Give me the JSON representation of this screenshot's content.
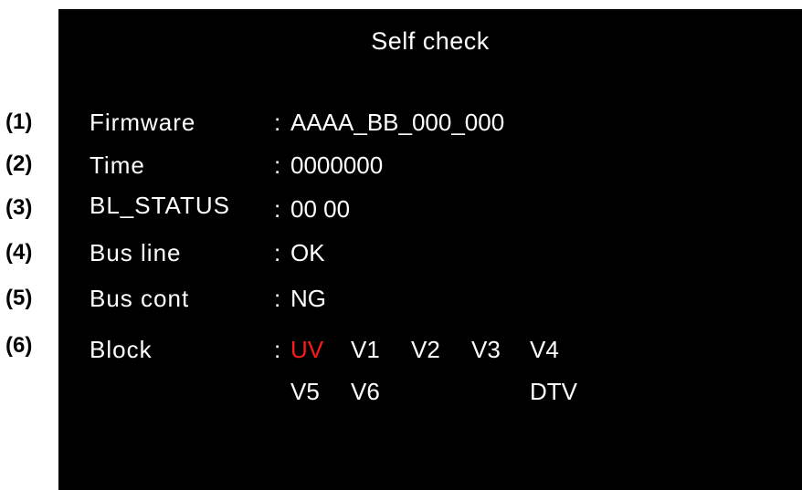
{
  "callouts": [
    "(1)",
    "(2)",
    "(3)",
    "(4)",
    "(5)",
    "(6)"
  ],
  "screen": {
    "title": "Self check",
    "colon": ":",
    "rows": [
      {
        "label": "Firmware",
        "value": "AAAA_BB_000_000"
      },
      {
        "label": "Time",
        "value": "0000000"
      },
      {
        "label": "BL_STATUS",
        "value": "00 00"
      },
      {
        "label": "Bus line",
        "value": "OK"
      },
      {
        "label": "Bus cont",
        "value": "NG"
      },
      {
        "label": "Block",
        "value": ""
      }
    ],
    "blocks": {
      "row1": [
        "UV",
        "V1",
        "V2",
        "V3",
        "V4"
      ],
      "row2": [
        "V5",
        "V6",
        "DTV"
      ],
      "alert_color": "#ff1a1a",
      "normal_color": "#ffffff"
    }
  }
}
